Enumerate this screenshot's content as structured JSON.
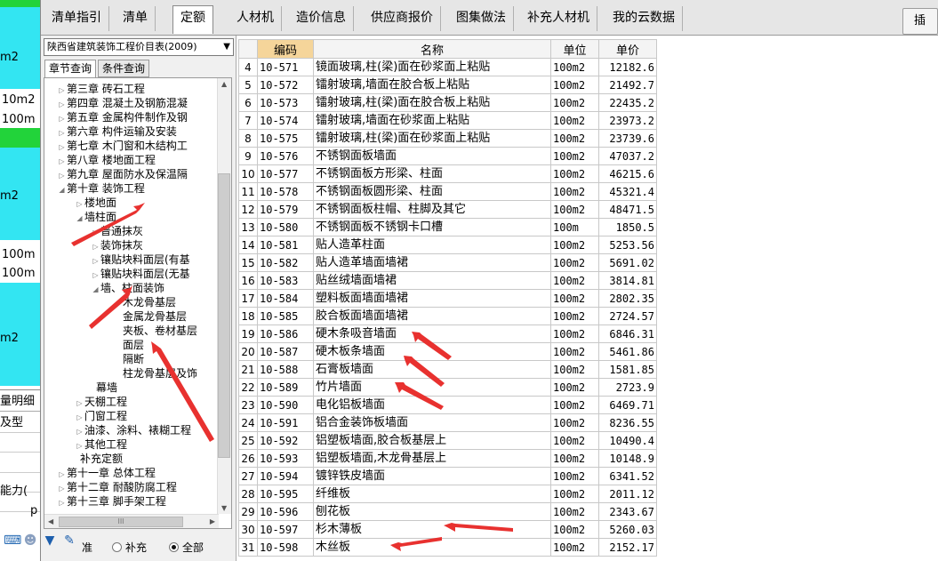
{
  "left_strip": {
    "bands": [
      {
        "color": "#33e5f2",
        "top": 0
      },
      {
        "color": "#33e5f2",
        "top": 0
      }
    ],
    "texts": [
      "m2",
      "10m2",
      "100m",
      "m2",
      "100m",
      "100m",
      "m2",
      "量明细",
      "及型",
      "能力(",
      "p"
    ]
  },
  "top_tabs": {
    "items": [
      "清单指引",
      "清单",
      "定额",
      "人材机",
      "造价信息",
      "供应商报价",
      "图集做法",
      "补充人材机",
      "我的云数据"
    ],
    "active": "定额",
    "insert_label": "插"
  },
  "left_panel": {
    "dropdown_value": "陕西省建筑装饰工程价目表(2009)",
    "sub_tabs": [
      "章节查询",
      "条件查询"
    ],
    "tree": [
      {
        "label": "第三章 砖石工程",
        "level": 0,
        "arrow": "▷"
      },
      {
        "label": "第四章 混凝土及钢筋混凝",
        "level": 0,
        "arrow": "▷"
      },
      {
        "label": "第五章 金属构件制作及钢",
        "level": 0,
        "arrow": "▷"
      },
      {
        "label": "第六章 构件运输及安装",
        "level": 0,
        "arrow": "▷"
      },
      {
        "label": "第七章 木门窗和木结构工",
        "level": 0,
        "arrow": "▷"
      },
      {
        "label": "第八章 楼地面工程",
        "level": 0,
        "arrow": "▷"
      },
      {
        "label": "第九章 屋面防水及保温隔",
        "level": 0,
        "arrow": "▷"
      },
      {
        "label": "第十章 装饰工程",
        "level": 0,
        "arrow": "◢"
      },
      {
        "label": "楼地面",
        "level": 1,
        "arrow": "▷"
      },
      {
        "label": "墙柱面",
        "level": 1,
        "arrow": "◢"
      },
      {
        "label": "普通抹灰",
        "level": 2,
        "arrow": "▷"
      },
      {
        "label": "装饰抹灰",
        "level": 2,
        "arrow": "▷"
      },
      {
        "label": "镶贴块料面层(有基",
        "level": 2,
        "arrow": "▷"
      },
      {
        "label": "镶贴块料面层(无基",
        "level": 2,
        "arrow": "▷"
      },
      {
        "label": "墙、柱面装饰",
        "level": 2,
        "arrow": "◢"
      },
      {
        "label": "木龙骨基层",
        "level": 3,
        "arrow": ""
      },
      {
        "label": "金属龙骨基层",
        "level": 3,
        "arrow": ""
      },
      {
        "label": "夹板、卷材基层",
        "level": 3,
        "arrow": ""
      },
      {
        "label": "面层",
        "level": 3,
        "arrow": ""
      },
      {
        "label": "隔断",
        "level": 3,
        "arrow": ""
      },
      {
        "label": "柱龙骨基层及饰",
        "level": 3,
        "arrow": ""
      },
      {
        "label": "幕墙",
        "level": 2,
        "arrow": ""
      },
      {
        "label": "天棚工程",
        "level": 1,
        "arrow": "▷"
      },
      {
        "label": "门窗工程",
        "level": 1,
        "arrow": "▷"
      },
      {
        "label": "油漆、涂料、裱糊工程",
        "level": 1,
        "arrow": "▷"
      },
      {
        "label": "其他工程",
        "level": 1,
        "arrow": "▷"
      },
      {
        "label": "补充定额",
        "level": 1,
        "arrow": ""
      },
      {
        "label": "第十一章 总体工程",
        "level": 0,
        "arrow": "▷"
      },
      {
        "label": "第十二章 耐酸防腐工程",
        "level": 0,
        "arrow": "▷"
      },
      {
        "label": "第十三章 脚手架工程",
        "level": 0,
        "arrow": "▷"
      }
    ],
    "radios": [
      {
        "label": "准",
        "checked": false
      },
      {
        "label": "补充",
        "checked": false
      },
      {
        "label": "全部",
        "checked": true
      }
    ]
  },
  "grid": {
    "headers": [
      "",
      "编码",
      "名称",
      "单位",
      "单价"
    ],
    "rows": [
      {
        "idx": "4",
        "code": "10-571",
        "name": "镜面玻璃,柱(梁)面在砂浆面上粘贴",
        "unit": "100m2",
        "price": "12182.6"
      },
      {
        "idx": "5",
        "code": "10-572",
        "name": "镭射玻璃,墙面在胶合板上粘贴",
        "unit": "100m2",
        "price": "21492.7"
      },
      {
        "idx": "6",
        "code": "10-573",
        "name": "镭射玻璃,柱(梁)面在胶合板上粘贴",
        "unit": "100m2",
        "price": "22435.2"
      },
      {
        "idx": "7",
        "code": "10-574",
        "name": "镭射玻璃,墙面在砂浆面上粘贴",
        "unit": "100m2",
        "price": "23973.2"
      },
      {
        "idx": "8",
        "code": "10-575",
        "name": "镭射玻璃,柱(梁)面在砂浆面上粘贴",
        "unit": "100m2",
        "price": "23739.6"
      },
      {
        "idx": "9",
        "code": "10-576",
        "name": "不锈钢面板墙面",
        "unit": "100m2",
        "price": "47037.2"
      },
      {
        "idx": "10",
        "code": "10-577",
        "name": "不锈钢面板方形梁、柱面",
        "unit": "100m2",
        "price": "46215.6"
      },
      {
        "idx": "11",
        "code": "10-578",
        "name": "不锈钢面板圆形梁、柱面",
        "unit": "100m2",
        "price": "45321.4"
      },
      {
        "idx": "12",
        "code": "10-579",
        "name": "不锈钢面板柱帽、柱脚及其它",
        "unit": "100m2",
        "price": "48471.5"
      },
      {
        "idx": "13",
        "code": "10-580",
        "name": "不锈钢面板不锈钢卡口槽",
        "unit": "100m",
        "price": "1850.5"
      },
      {
        "idx": "14",
        "code": "10-581",
        "name": "贴人造革柱面",
        "unit": "100m2",
        "price": "5253.56"
      },
      {
        "idx": "15",
        "code": "10-582",
        "name": "贴人造革墙面墙裙",
        "unit": "100m2",
        "price": "5691.02"
      },
      {
        "idx": "16",
        "code": "10-583",
        "name": "贴丝绒墙面墙裙",
        "unit": "100m2",
        "price": "3814.81"
      },
      {
        "idx": "17",
        "code": "10-584",
        "name": "塑料板面墙面墙裙",
        "unit": "100m2",
        "price": "2802.35"
      },
      {
        "idx": "18",
        "code": "10-585",
        "name": "胶合板面墙面墙裙",
        "unit": "100m2",
        "price": "2724.57"
      },
      {
        "idx": "19",
        "code": "10-586",
        "name": "硬木条吸音墙面",
        "unit": "100m2",
        "price": "6846.31"
      },
      {
        "idx": "20",
        "code": "10-587",
        "name": "硬木板条墙面",
        "unit": "100m2",
        "price": "5461.86"
      },
      {
        "idx": "21",
        "code": "10-588",
        "name": "石膏板墙面",
        "unit": "100m2",
        "price": "1581.85"
      },
      {
        "idx": "22",
        "code": "10-589",
        "name": "竹片墙面",
        "unit": "100m2",
        "price": "2723.9"
      },
      {
        "idx": "23",
        "code": "10-590",
        "name": "电化铝板墙面",
        "unit": "100m2",
        "price": "6469.71"
      },
      {
        "idx": "24",
        "code": "10-591",
        "name": "铝合金装饰板墙面",
        "unit": "100m2",
        "price": "8236.55"
      },
      {
        "idx": "25",
        "code": "10-592",
        "name": "铝塑板墙面,胶合板基层上",
        "unit": "100m2",
        "price": "10490.4"
      },
      {
        "idx": "26",
        "code": "10-593",
        "name": "铝塑板墙面,木龙骨基层上",
        "unit": "100m2",
        "price": "10148.9"
      },
      {
        "idx": "27",
        "code": "10-594",
        "name": "镀锌铁皮墙面",
        "unit": "100m2",
        "price": "6341.52"
      },
      {
        "idx": "28",
        "code": "10-595",
        "name": "纤维板",
        "unit": "100m2",
        "price": "2011.12"
      },
      {
        "idx": "29",
        "code": "10-596",
        "name": "刨花板",
        "unit": "100m2",
        "price": "2343.67"
      },
      {
        "idx": "30",
        "code": "10-597",
        "name": "杉木薄板",
        "unit": "100m2",
        "price": "5260.03"
      },
      {
        "idx": "31",
        "code": "10-598",
        "name": "木丝板",
        "unit": "100m2",
        "price": "2152.17"
      }
    ]
  },
  "colors": {
    "accent_cyan": "#33e5f2",
    "accent_green": "#22d33a",
    "arrow_red": "#e8312f",
    "header_code": "#f5d59a"
  },
  "icons": [
    "keyboard-icon",
    "users-icon",
    "shirt-icon",
    "wrench-icon"
  ]
}
